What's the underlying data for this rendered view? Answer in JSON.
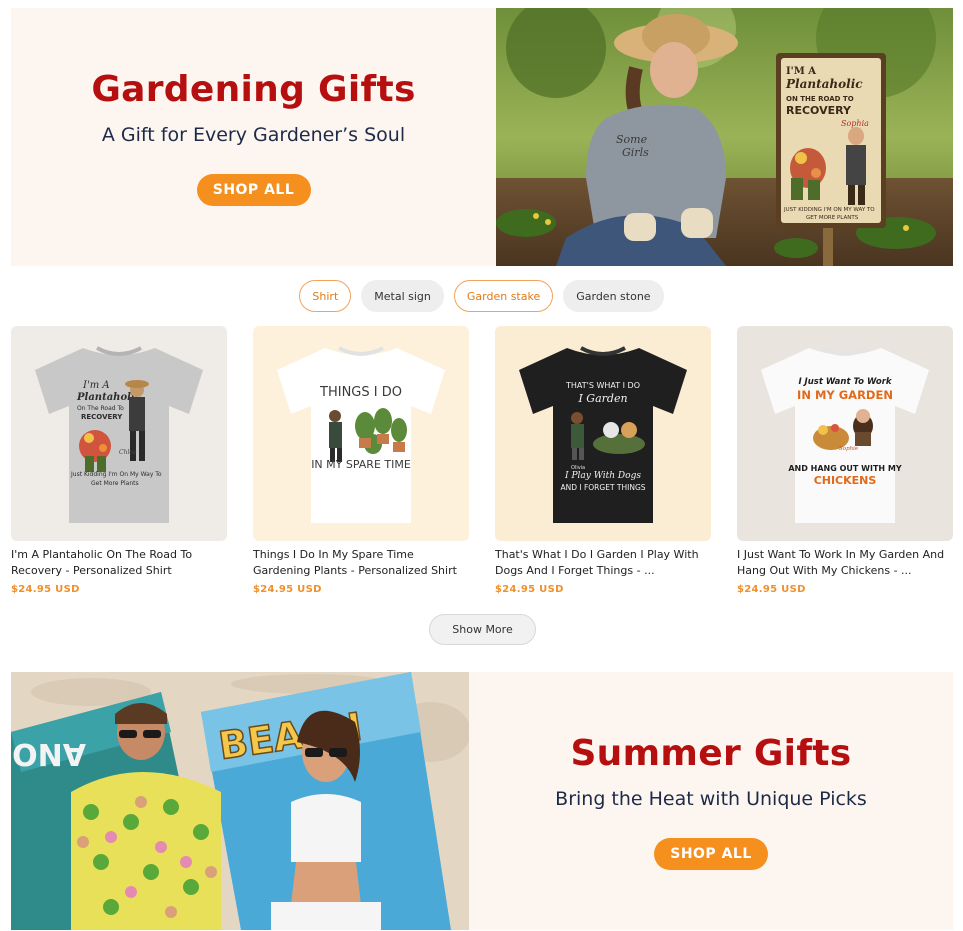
{
  "hero_gardening": {
    "title": "Gardening Gifts",
    "subtitle": "A Gift for Every Gardener’s Soul",
    "button": "SHOP ALL",
    "sign_text": [
      "I'M A",
      "Plantaholic",
      "ON THE ROAD TO",
      "RECOVERY",
      "Sophia",
      "JUST KIDDING I'M ON MY WAY TO",
      "GET MORE PLANTS"
    ],
    "shirt_text": [
      "Some",
      "Girls"
    ]
  },
  "chips": [
    {
      "label": "Shirt",
      "style": "outline"
    },
    {
      "label": "Metal sign",
      "style": "filled"
    },
    {
      "label": "Garden stake",
      "style": "outline"
    },
    {
      "label": "Garden stone",
      "style": "filled"
    }
  ],
  "products": [
    {
      "title": "I'm A Plantaholic On The Road To Recovery - Personalized Shirt",
      "price": "$24.95 USD",
      "shirt_color": "#c9c9c9",
      "bg": "#efebe6",
      "print": [
        "I'm A",
        "Plantaholic",
        "On The Road To",
        "RECOVERY",
        "Chloe",
        "Just Kidding I'm On My Way To",
        "Get More Plants"
      ]
    },
    {
      "title": "Things I Do In My Spare Time Gardening Plants - Personalized Shirt",
      "price": "$24.95 USD",
      "shirt_color": "#ffffff",
      "bg": "#fdf1dc",
      "print": [
        "THINGS I DO",
        "IN MY SPARE TIME"
      ]
    },
    {
      "title": "That's What I Do I Garden I Play With Dogs And I Forget Things - ...",
      "price": "$24.95 USD",
      "shirt_color": "#1f1f1f",
      "bg": "#fbecd4",
      "print": [
        "THAT'S WHAT I DO",
        "I Garden",
        "Olivia",
        "I Play With Dogs",
        "AND I FORGET THINGS"
      ]
    },
    {
      "title": "I Just Want To Work In My Garden And Hang Out With My Chickens - ...",
      "price": "$24.95 USD",
      "shirt_color": "#fafafa",
      "bg": "#e9e4de",
      "print": [
        "I Just Want To Work",
        "IN MY GARDEN",
        "Sophie",
        "AND HANG OUT WITH MY",
        "CHICKENS"
      ]
    }
  ],
  "show_more": "Show More",
  "hero_summer": {
    "title": "Summer Gifts",
    "subtitle": "Bring the Heat with Unique Picks",
    "button": "SHOP ALL",
    "towel_text": [
      "BEACH",
      "ANO"
    ]
  }
}
